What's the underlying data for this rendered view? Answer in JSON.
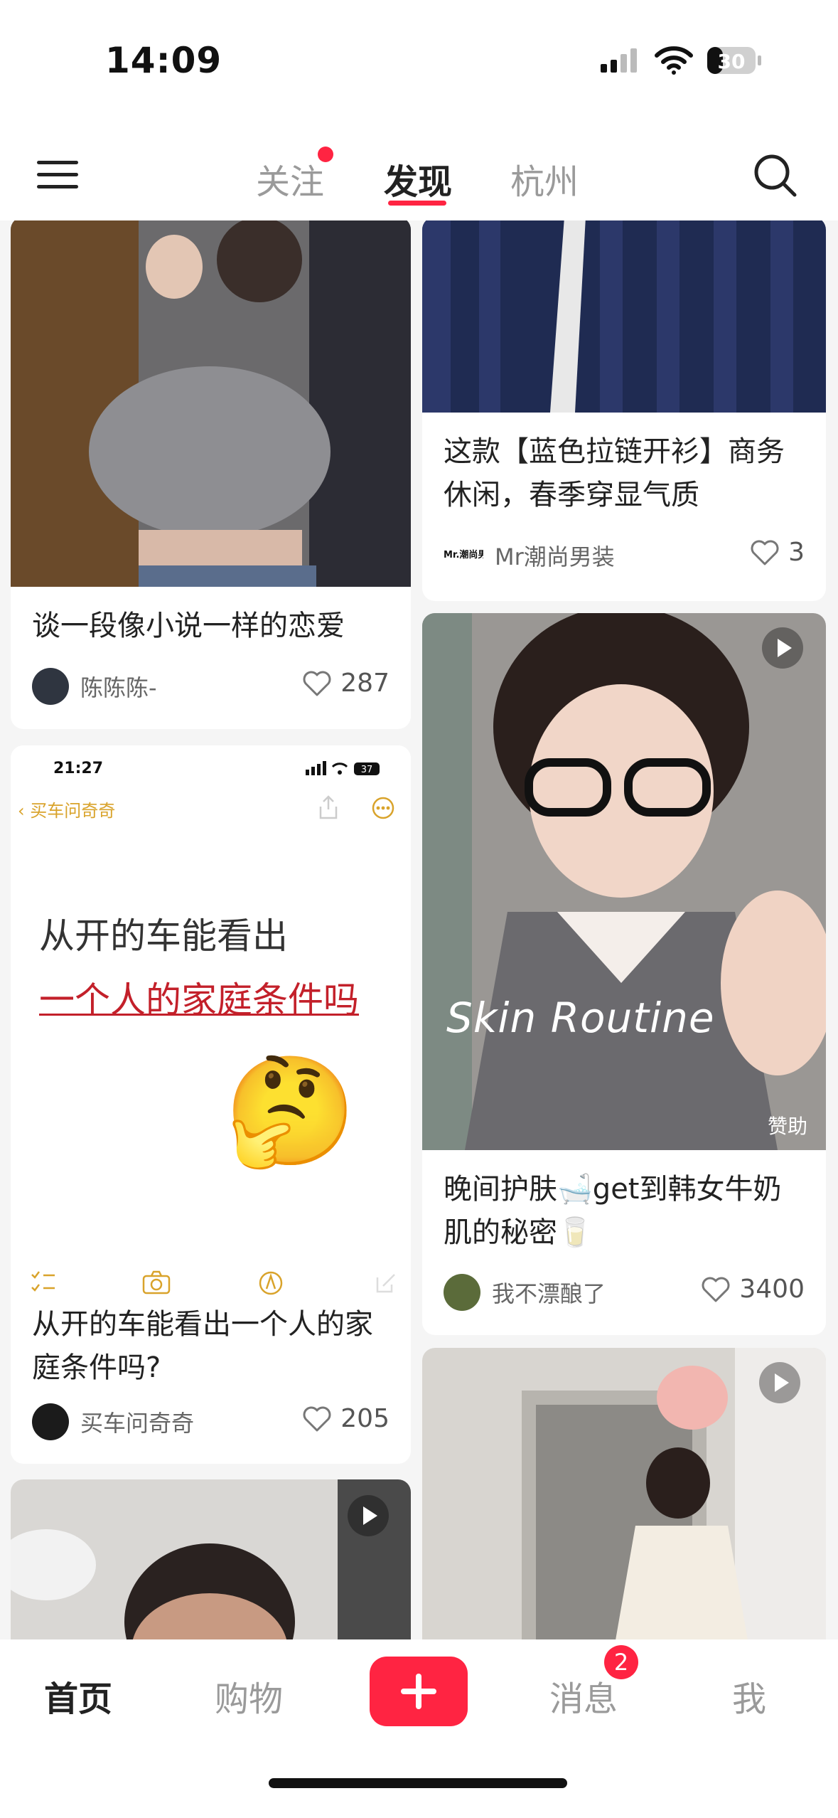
{
  "status_bar": {
    "time": "14:09",
    "battery": "30"
  },
  "top_tabs": [
    {
      "label": "关注",
      "has_dot": true
    },
    {
      "label": "发现",
      "active": true
    },
    {
      "label": "杭州"
    }
  ],
  "feed": {
    "left": [
      {
        "title": "谈一段像小说一样的恋爱",
        "author": "陈陈陈-",
        "likes": "287"
      },
      {
        "screenshot": {
          "time": "21:27",
          "battery": "37",
          "back_label": "买车问奇奇",
          "line1": "从开的车能看出",
          "line2": "一个人的家庭条件吗",
          "emoji": "🤔"
        },
        "title": "从开的车能看出一个人的家庭条件吗?",
        "author": "买车问奇奇",
        "likes": "205"
      }
    ],
    "right": [
      {
        "title": "这款【蓝色拉链开衫】商务休闲，春季穿显气质",
        "author": "Mr潮尚男装",
        "author_logo": "Mr.潮尚男装",
        "likes": "3"
      },
      {
        "overlay_text": "Skin Routine",
        "sponsored": "赞助",
        "title": "晚间护肤🛁get到韩女牛奶肌的秘密🥛",
        "author": "我不漂酿了",
        "likes": "3400"
      }
    ]
  },
  "bottom_nav": [
    {
      "label": "首页",
      "active": true
    },
    {
      "label": "购物"
    },
    {
      "label": "消息",
      "badge": "2"
    },
    {
      "label": "我"
    }
  ],
  "colors": {
    "accent": "#ff2442"
  }
}
